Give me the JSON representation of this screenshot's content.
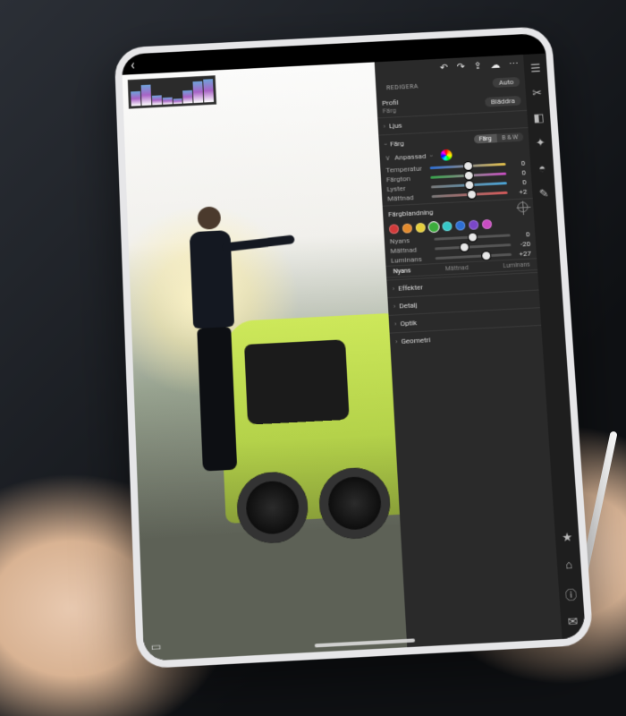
{
  "header": {
    "section": "REDIGERA",
    "auto": "Auto",
    "profile_label": "Profil",
    "profile_sub": "Färg",
    "browse": "Bläddra"
  },
  "panels": {
    "light": "Ljus",
    "color": "Färg",
    "color_seg": {
      "left": "Färg",
      "right": "B & W"
    },
    "custom": "Anpassad",
    "effects": "Effekter",
    "detail": "Detalj",
    "optics": "Optik",
    "geometry": "Geometri"
  },
  "sliders": {
    "temperature": {
      "label": "Temperatur",
      "value": "0",
      "pos": 50
    },
    "tint": {
      "label": "Färgton",
      "value": "0",
      "pos": 50
    },
    "vibrance": {
      "label": "Lyster",
      "value": "0",
      "pos": 50
    },
    "saturation": {
      "label": "Mättnad",
      "value": "+2",
      "pos": 52
    }
  },
  "colormix": {
    "title": "Färgblandning",
    "swatches": [
      "#d23a3a",
      "#e38a2c",
      "#e6cf3c",
      "#3cab3c",
      "#36c7c7",
      "#2e6fd4",
      "#7a47c9",
      "#c94cc2"
    ],
    "selected": 3,
    "hue": {
      "label": "Nyans",
      "value": "0",
      "pos": 50
    },
    "sat": {
      "label": "Mättnad",
      "value": "-20",
      "pos": 38
    },
    "luminance": {
      "label": "Luminans",
      "value": "+27",
      "pos": 66
    },
    "tabs": {
      "hue": "Nyans",
      "sat": "Mättnad",
      "lum": "Luminans"
    }
  }
}
